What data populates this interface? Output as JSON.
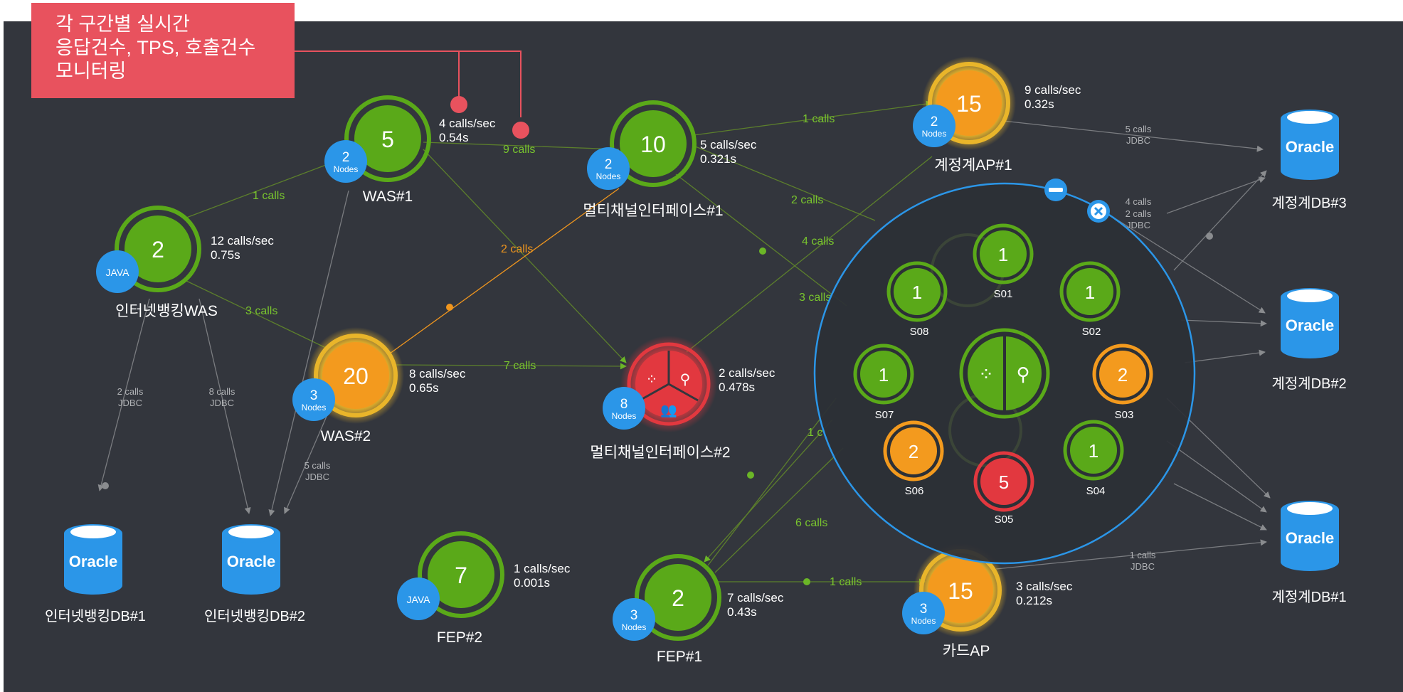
{
  "callout": {
    "lines": [
      "각 구간별 실시간",
      "응답건수, TPS, 호출건수",
      "모니터링"
    ]
  },
  "colors": {
    "background": "#33363d",
    "green": "#5aa919",
    "orange": "#f39a1e",
    "red": "#e2383f",
    "blue": "#2b96e8",
    "gold_glow": "#e9b52a",
    "edge_green": "#6bb627",
    "edge_orange": "#f0961e",
    "callout": "#e8525e"
  },
  "nodes": [
    {
      "id": "ibwas",
      "name": "인터넷뱅킹WAS",
      "value": "2",
      "status": "green",
      "badge_type": "java",
      "badge_text": "JAVA",
      "stat1": "12 calls/sec",
      "stat2": "0.75s"
    },
    {
      "id": "was1",
      "name": "WAS#1",
      "value": "5",
      "status": "green",
      "badge_type": "nodes",
      "badge_text": "2",
      "badge_sub": "Nodes",
      "stat1": "4 calls/sec",
      "stat2": "0.54s"
    },
    {
      "id": "was2",
      "name": "WAS#2",
      "value": "20",
      "status": "orange",
      "badge_type": "nodes",
      "badge_text": "3",
      "badge_sub": "Nodes",
      "stat1": "8 calls/sec",
      "stat2": "0.65s"
    },
    {
      "id": "mc1",
      "name": "멀티채널인터페이스#1",
      "value": "10",
      "status": "green",
      "badge_type": "nodes",
      "badge_text": "2",
      "badge_sub": "Nodes",
      "stat1": "5 calls/sec",
      "stat2": "0.321s"
    },
    {
      "id": "mc2",
      "name": "멀티채널인터페이스#2",
      "value": "",
      "status": "red",
      "badge_type": "nodes",
      "badge_text": "8",
      "badge_sub": "Nodes",
      "stat1": "2 calls/sec",
      "stat2": "0.478s"
    },
    {
      "id": "ap1",
      "name": "계정계AP#1",
      "value": "15",
      "status": "orange",
      "badge_type": "nodes",
      "badge_text": "2",
      "badge_sub": "Nodes",
      "stat1": "9 calls/sec",
      "stat2": "0.32s"
    },
    {
      "id": "fep2",
      "name": "FEP#2",
      "value": "7",
      "status": "green",
      "badge_type": "java",
      "badge_text": "JAVA",
      "stat1": "1 calls/sec",
      "stat2": "0.001s"
    },
    {
      "id": "fep1",
      "name": "FEP#1",
      "value": "2",
      "status": "green",
      "badge_type": "nodes",
      "badge_text": "3",
      "badge_sub": "Nodes",
      "stat1": "7 calls/sec",
      "stat2": "0.43s"
    },
    {
      "id": "card",
      "name": "카드AP",
      "value": "15",
      "status": "orange",
      "badge_type": "nodes",
      "badge_text": "3",
      "badge_sub": "Nodes",
      "stat1": "3 calls/sec",
      "stat2": "0.212s"
    }
  ],
  "databases": [
    {
      "id": "ibdb1",
      "label": "Oracle",
      "name": "인터넷뱅킹DB#1"
    },
    {
      "id": "ibdb2",
      "label": "Oracle",
      "name": "인터넷뱅킹DB#2"
    },
    {
      "id": "db3",
      "label": "Oracle",
      "name": "계정계DB#3"
    },
    {
      "id": "db2",
      "label": "Oracle",
      "name": "계정계DB#2"
    },
    {
      "id": "db1",
      "label": "Oracle",
      "name": "계정계DB#1"
    }
  ],
  "edge_labels": [
    {
      "id": "e1",
      "text": "1 calls",
      "color": "green"
    },
    {
      "id": "e2",
      "text": "3 calls",
      "color": "green"
    },
    {
      "id": "e3",
      "text": "9 calls",
      "color": "green"
    },
    {
      "id": "e4",
      "text": "2 calls",
      "color": "orange"
    },
    {
      "id": "e5",
      "text": "7 calls",
      "color": "green"
    },
    {
      "id": "e6",
      "text": "1 calls",
      "color": "green"
    },
    {
      "id": "e7",
      "text": "2 calls",
      "color": "green"
    },
    {
      "id": "e8",
      "text": "4 calls",
      "color": "green"
    },
    {
      "id": "e9",
      "text": "3 calls",
      "color": "green"
    },
    {
      "id": "e10",
      "text": "6 calls",
      "color": "green"
    },
    {
      "id": "e11",
      "text": "1 calls",
      "color": "green"
    },
    {
      "id": "e12",
      "text": "1 c",
      "color": "green"
    }
  ],
  "jdbc_labels": [
    {
      "id": "j1",
      "line1": "2 calls",
      "line2": "JDBC"
    },
    {
      "id": "j2",
      "line1": "8 calls",
      "line2": "JDBC"
    },
    {
      "id": "j3",
      "line1": "5 calls",
      "line2": "JDBC"
    },
    {
      "id": "j4",
      "line1": "5 calls",
      "line2": "JDBC"
    },
    {
      "id": "j5",
      "line1": "4 calls",
      "line2": "JDBC"
    },
    {
      "id": "j6",
      "line1": "2 calls",
      "line2": "JDBC"
    },
    {
      "id": "j7",
      "line1": "1 calls",
      "line2": "JDBC"
    }
  ],
  "popup": {
    "center_icons": [
      "grid-icon",
      "search-icon"
    ],
    "minimize_icon": "minus-icon",
    "close_icon": "close-icon",
    "servers": [
      {
        "name": "S01",
        "value": "1",
        "status": "green"
      },
      {
        "name": "S02",
        "value": "1",
        "status": "green"
      },
      {
        "name": "S03",
        "value": "2",
        "status": "orange"
      },
      {
        "name": "S04",
        "value": "1",
        "status": "green"
      },
      {
        "name": "S05",
        "value": "5",
        "status": "red"
      },
      {
        "name": "S06",
        "value": "2",
        "status": "orange"
      },
      {
        "name": "S07",
        "value": "1",
        "status": "green"
      },
      {
        "name": "S08",
        "value": "1",
        "status": "green"
      }
    ]
  },
  "mc2_icons": [
    "grid-icon",
    "search-icon",
    "users-icon"
  ]
}
